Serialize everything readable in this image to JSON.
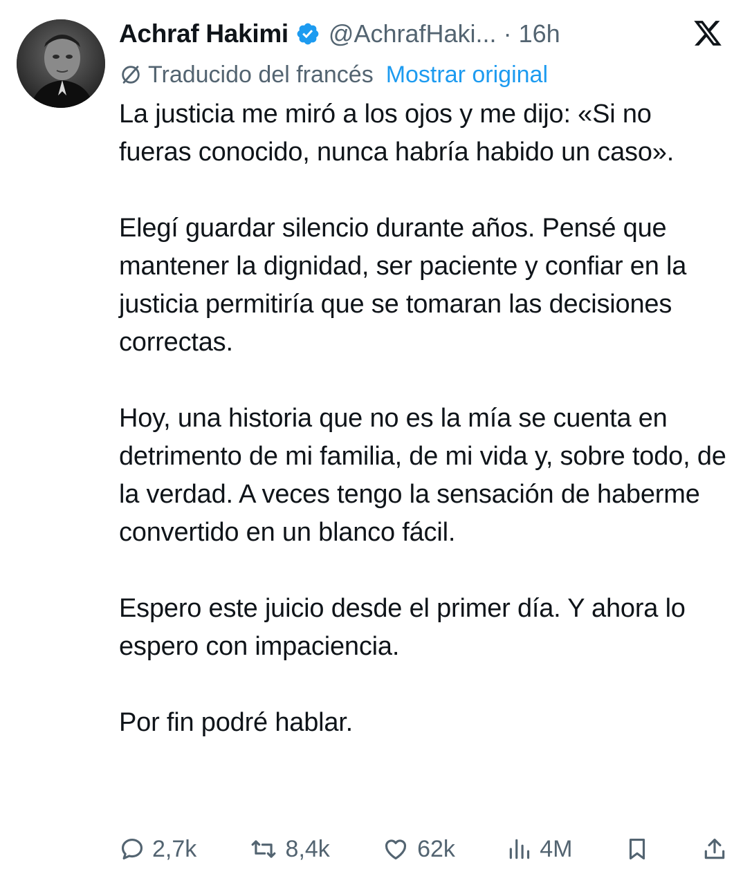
{
  "author": {
    "name": "Achraf Hakimi",
    "handle": "@AchrafHaki...",
    "separator": "·",
    "time": "16h",
    "verified": true
  },
  "translation": {
    "label": "Traducido del francés",
    "show_original": "Mostrar original"
  },
  "tweet": {
    "paragraphs": [
      "La justicia me miró a los ojos y me dijo: «Si no fueras conocido, nunca habría habido un caso».",
      "Elegí guardar silencio durante años. Pensé que mantener la dignidad, ser paciente y confiar en la justicia permitiría que se tomaran las decisiones correctas.",
      "Hoy, una historia que no es la mía se cuenta en detrimento de mi familia, de mi vida y, sobre todo, de la verdad. A veces tengo la sensación de haberme convertido en un blanco fácil.",
      "Espero este juicio desde el primer día. Y ahora lo espero con impaciencia.",
      "Por fin podré hablar."
    ]
  },
  "actions": {
    "replies": "2,7k",
    "reposts": "8,4k",
    "likes": "62k",
    "views": "4M"
  },
  "icons": {
    "verified": "verified-badge-icon",
    "translate": "translate-icon",
    "logo": "x-logo-icon",
    "reply": "reply-icon",
    "repost": "repost-icon",
    "like": "heart-icon",
    "views": "views-icon",
    "bookmark": "bookmark-icon",
    "share": "share-icon"
  },
  "colors": {
    "text": "#0f1419",
    "secondary": "#536471",
    "accent": "#1d9bf0"
  }
}
